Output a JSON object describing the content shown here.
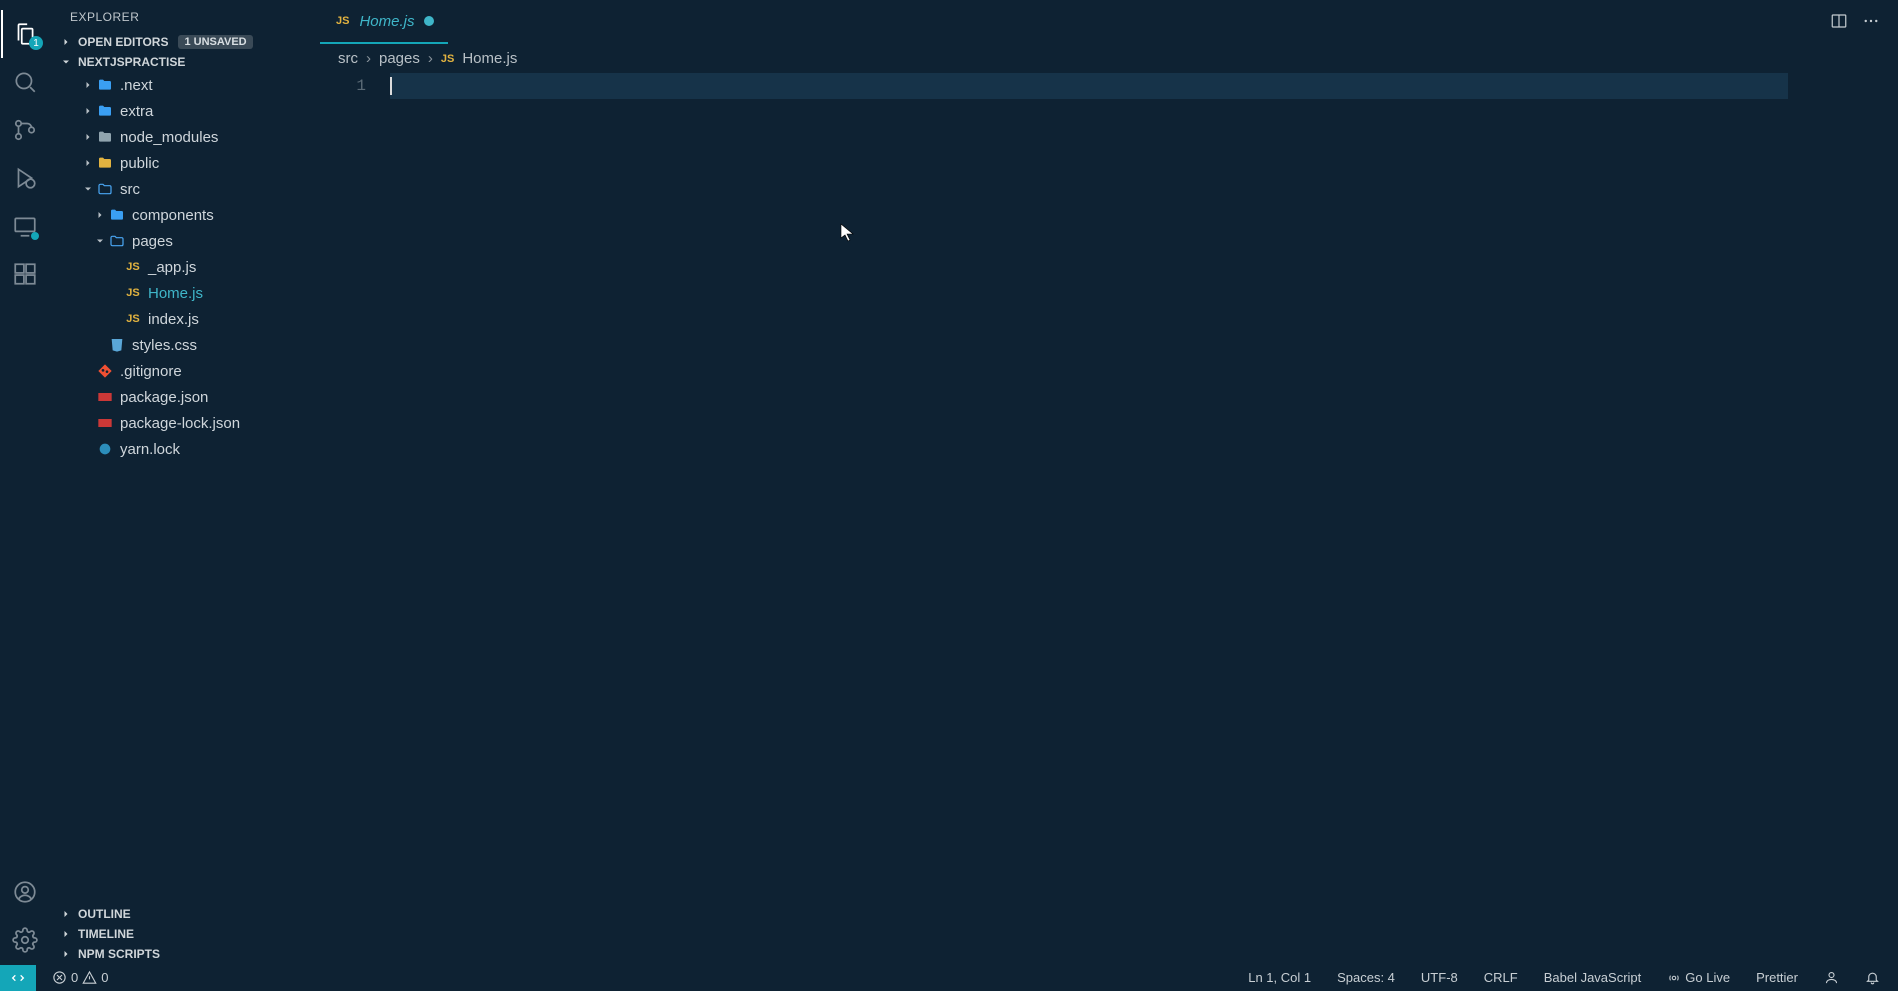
{
  "sidebar": {
    "title": "EXPLORER",
    "openEditorsLabel": "OPEN EDITORS",
    "unsaved": "1 UNSAVED",
    "projectName": "NEXTJSPRACTISE",
    "outline": "OUTLINE",
    "timeline": "TIMELINE",
    "npmScripts": "NPM SCRIPTS"
  },
  "tree": {
    "next": ".next",
    "extra": "extra",
    "node_modules": "node_modules",
    "public": "public",
    "src": "src",
    "components": "components",
    "pages": "pages",
    "app": "_app.js",
    "home": "Home.js",
    "index": "index.js",
    "styles": "styles.css",
    "gitignore": ".gitignore",
    "pkg": "package.json",
    "pkglock": "package-lock.json",
    "yarn": "yarn.lock"
  },
  "tab": {
    "label": "Home.js",
    "jsBadge": "JS"
  },
  "breadcrumbs": {
    "seg1": "src",
    "seg2": "pages",
    "seg3js": "JS",
    "seg3": "Home.js"
  },
  "editor": {
    "line1": "1"
  },
  "status": {
    "errors": "0",
    "warnings": "0",
    "lncol": "Ln 1, Col 1",
    "spaces": "Spaces: 4",
    "encoding": "UTF-8",
    "eol": "CRLF",
    "lang": "Babel JavaScript",
    "golive": "Go Live",
    "prettier": "Prettier"
  },
  "activity": {
    "explorerBadge": "1"
  }
}
